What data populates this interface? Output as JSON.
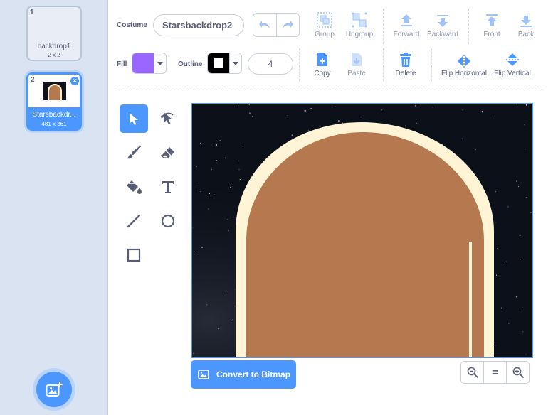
{
  "backdrops": [
    {
      "index": "1",
      "name": "backdrop1",
      "size": "2 x 2",
      "selected": false
    },
    {
      "index": "2",
      "name": "Starsbackdr...",
      "size": "481 x 361",
      "selected": true
    }
  ],
  "toolbar": {
    "costume_label": "Costume",
    "costume_name": "Starsbackdrop2",
    "fill_label": "Fill",
    "outline_label": "Outline",
    "fill_color": "#9966ff",
    "outline_color": "#000000",
    "stroke_width": "4",
    "buttons": {
      "group": "Group",
      "ungroup": "Ungroup",
      "forward": "Forward",
      "backward": "Backward",
      "front": "Front",
      "back": "Back",
      "copy": "Copy",
      "paste": "Paste",
      "delete": "Delete",
      "flip_horizontal": "Flip Horizontal",
      "flip_vertical": "Flip Vertical"
    }
  },
  "tools": [
    "select",
    "reshape",
    "brush",
    "eraser",
    "fill",
    "text",
    "line",
    "circle",
    "rectangle"
  ],
  "selected_tool": "select",
  "convert_label": "Convert to Bitmap",
  "zoom_reset_label": "=",
  "colors": {
    "accent": "#4c97ff",
    "sidebar_bg": "#d9e3f2",
    "arch_fill": "#b5784f",
    "arch_outline": "#fff5d6",
    "sky": "#0c1019"
  }
}
